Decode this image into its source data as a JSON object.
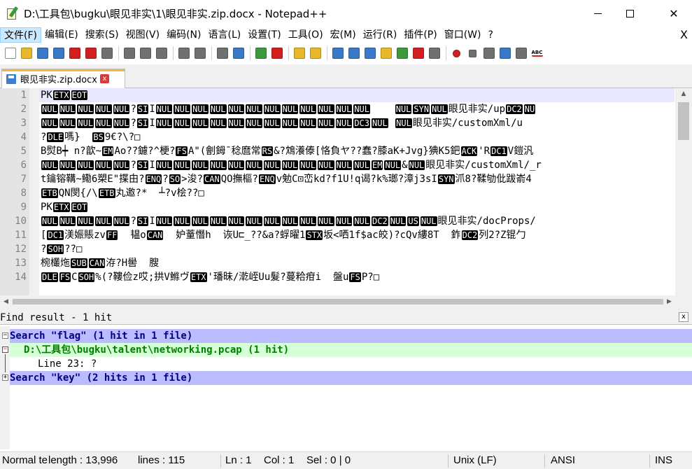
{
  "window": {
    "title": "D:\\工具包\\bugku\\眼见非实\\1\\眼见非实.zip.docx - Notepad++",
    "minimize_glyph": "",
    "maximize_glyph": "",
    "close_glyph": "✕"
  },
  "menu": {
    "items": [
      "文件(F)",
      "编辑(E)",
      "搜索(S)",
      "视图(V)",
      "编码(N)",
      "语言(L)",
      "设置(T)",
      "工具(O)",
      "宏(M)",
      "运行(R)",
      "插件(P)",
      "窗口(W)",
      "?"
    ],
    "close_x": "X"
  },
  "toolbar": {
    "icons": [
      "new-file-icon",
      "open-file-icon",
      "save-icon",
      "save-all-icon",
      "close-icon",
      "close-all-icon",
      "print-icon",
      "cut-icon",
      "copy-icon",
      "paste-icon",
      "undo-icon",
      "redo-icon",
      "find-icon",
      "replace-icon",
      "zoom-in-icon",
      "zoom-out-icon",
      "sync-v-icon",
      "sync-h-icon",
      "word-wrap-icon",
      "show-all-chars-icon",
      "indent-guide-icon",
      "doc-map-icon",
      "function-list-icon",
      "folder-workspace-icon",
      "monitor-icon",
      "record-macro-icon",
      "stop-macro-icon",
      "play-macro-icon",
      "run-macro-multiple-icon",
      "save-macro-icon",
      "spell-check-icon"
    ],
    "colors": {
      "blue": "#3a78c8",
      "green": "#3c9a3c",
      "red": "#d22020",
      "gray": "#707070",
      "yellow": "#e8b82a"
    }
  },
  "tab": {
    "label": "眼见非实.zip.docx",
    "close": "x"
  },
  "editor": {
    "line_numbers": [
      "1",
      "2",
      "3",
      "4",
      "5",
      "6",
      "7",
      "8",
      "9",
      "10",
      "11",
      "12",
      "13",
      "14"
    ],
    "lines": [
      [
        {
          "t": "PK"
        },
        {
          "k": "ETX"
        },
        {
          "k": "EOT"
        }
      ],
      [
        {
          "k": "NUL"
        },
        {
          "k": "NUL"
        },
        {
          "k": "NUL"
        },
        {
          "k": "NUL"
        },
        {
          "k": "NUL"
        },
        {
          "t": "?"
        },
        {
          "k": "SI"
        },
        {
          "t": "I"
        },
        {
          "k": "NUL"
        },
        {
          "k": "NUL"
        },
        {
          "k": "NUL"
        },
        {
          "k": "NUL"
        },
        {
          "k": "NUL"
        },
        {
          "k": "NUL"
        },
        {
          "k": "NUL"
        },
        {
          "k": "NUL"
        },
        {
          "k": "NUL"
        },
        {
          "k": "NUL"
        },
        {
          "k": "NUL"
        },
        {
          "k": "NUL"
        },
        {
          "t": "    "
        },
        {
          "k": "NUL"
        },
        {
          "k": "SYN"
        },
        {
          "k": "NUL"
        },
        {
          "t": "眼见非实/up"
        },
        {
          "k": "DC2"
        },
        {
          "k": "NU"
        }
      ],
      [
        {
          "k": "NUL"
        },
        {
          "k": "NUL"
        },
        {
          "k": "NUL"
        },
        {
          "k": "NUL"
        },
        {
          "k": "NUL"
        },
        {
          "t": "?"
        },
        {
          "k": "SI"
        },
        {
          "t": "I"
        },
        {
          "k": "NUL"
        },
        {
          "k": "NUL"
        },
        {
          "k": "NUL"
        },
        {
          "k": "NUL"
        },
        {
          "k": "NUL"
        },
        {
          "k": "NUL"
        },
        {
          "k": "NUL"
        },
        {
          "k": "NUL"
        },
        {
          "k": "NUL"
        },
        {
          "k": "NUL"
        },
        {
          "k": "NUL"
        },
        {
          "k": "DC3"
        },
        {
          "k": "NUL"
        },
        {
          "t": " "
        },
        {
          "k": "NUL"
        },
        {
          "t": "眼见非实/customXml/u"
        }
      ],
      [
        {
          "t": "?"
        },
        {
          "k": "DLE"
        },
        {
          "t": "嗎}  "
        },
        {
          "k": "BS"
        },
        {
          "t": "9€?\\?□"
        }
      ],
      [
        {
          "t": "B熨B┿ n?歆~"
        },
        {
          "k": "EM"
        },
        {
          "t": "Ao??鑢?^梗?"
        },
        {
          "k": "FS"
        },
        {
          "t": "A\"(劊鉧¯稔麿常"
        },
        {
          "k": "RS"
        },
        {
          "t": "&?鴆瀁傣[恪負ヤ??蠢?膝aK+Jvg}猠K5鈀"
        },
        {
          "k": "ACK"
        },
        {
          "t": "'R"
        },
        {
          "k": "DC1"
        },
        {
          "t": "V鎧汎"
        }
      ],
      [
        {
          "k": "NUL"
        },
        {
          "k": "NUL"
        },
        {
          "k": "NUL"
        },
        {
          "k": "NUL"
        },
        {
          "k": "NUL"
        },
        {
          "t": "?"
        },
        {
          "k": "SI"
        },
        {
          "t": "I"
        },
        {
          "k": "NUL"
        },
        {
          "k": "NUL"
        },
        {
          "k": "NUL"
        },
        {
          "k": "NUL"
        },
        {
          "k": "NUL"
        },
        {
          "k": "NUL"
        },
        {
          "k": "NUL"
        },
        {
          "k": "NUL"
        },
        {
          "k": "NUL"
        },
        {
          "k": "NUL"
        },
        {
          "k": "NUL"
        },
        {
          "k": "NUL"
        },
        {
          "k": "EM"
        },
        {
          "k": "NUL"
        },
        {
          "t": "&"
        },
        {
          "k": "NUL"
        },
        {
          "t": "眼见非实/customXml/_r"
        }
      ],
      [
        {
          "t": "t鑰镕鞲~鰳6槊E\"揲甶?"
        },
        {
          "k": "ENQ"
        },
        {
          "t": "?"
        },
        {
          "k": "SO"
        },
        {
          "t": ">浚?"
        },
        {
          "k": "CAN"
        },
        {
          "t": "QO撫樞?"
        },
        {
          "k": "ENQ"
        },
        {
          "t": "v勉C⊡峦kd?f1U!q谒?k%瑯?漳j3sI"
        },
        {
          "k": "SYN"
        },
        {
          "t": "沠8?鞣劬仳跋嵛4"
        }
      ],
      [
        {
          "k": "ETB"
        },
        {
          "t": "QN閔{/\\"
        },
        {
          "k": "ETB"
        },
        {
          "t": "丸邀?*  ┴?v桧??□"
        }
      ],
      [
        {
          "t": "PK"
        },
        {
          "k": "ETX"
        },
        {
          "k": "EOT"
        }
      ],
      [
        {
          "k": "NUL"
        },
        {
          "k": "NUL"
        },
        {
          "k": "NUL"
        },
        {
          "k": "NUL"
        },
        {
          "k": "NUL"
        },
        {
          "t": "?"
        },
        {
          "k": "SI"
        },
        {
          "t": "I"
        },
        {
          "k": "NUL"
        },
        {
          "k": "NUL"
        },
        {
          "k": "NUL"
        },
        {
          "k": "NUL"
        },
        {
          "k": "NUL"
        },
        {
          "k": "NUL"
        },
        {
          "k": "NUL"
        },
        {
          "k": "NUL"
        },
        {
          "k": "NUL"
        },
        {
          "k": "NUL"
        },
        {
          "k": "NUL"
        },
        {
          "k": "NUL"
        },
        {
          "k": "DC2"
        },
        {
          "k": "NUL"
        },
        {
          "k": "US"
        },
        {
          "k": "NUL"
        },
        {
          "t": "眼见非实/docProps/"
        }
      ],
      [
        {
          "t": "["
        },
        {
          "k": "DC1"
        },
        {
          "t": "渼娠賬zv"
        },
        {
          "k": "FF"
        },
        {
          "t": "  韫o"
        },
        {
          "k": "CAN"
        },
        {
          "t": "  妒蕫憯h  诙U⊏_??&a?蜉曜1"
        },
        {
          "k": "STX"
        },
        {
          "t": "坂<哂1f$ac皎)?cQv縷8T  鈼"
        },
        {
          "k": "DC2"
        },
        {
          "t": "列2?Z锟勹"
        }
      ],
      [
        {
          "t": "?"
        },
        {
          "k": "SOH"
        },
        {
          "t": "??□"
        }
      ],
      [
        {
          "t": "椀欉炧"
        },
        {
          "k": "SUB"
        },
        {
          "k": "CAN"
        },
        {
          "t": "洊?H嚳  膄"
        }
      ],
      [
        {
          "k": "DLE"
        },
        {
          "k": "FS"
        },
        {
          "t": "C"
        },
        {
          "k": "SOH"
        },
        {
          "t": "%(?鞻俭z哎;拱V鰷ヴ"
        },
        {
          "k": "ETX"
        },
        {
          "t": "'璠昧/漧峌Uu髮?蔓粭疳i  盤u"
        },
        {
          "k": "FS"
        },
        {
          "t": "P?□"
        }
      ]
    ]
  },
  "find_results": {
    "title": "Find result - 1 hit",
    "close": "x",
    "rows": [
      {
        "kind": "search",
        "text": "Search \"flag\" (1 hit in 1 file)",
        "fold": "⊟"
      },
      {
        "kind": "file",
        "text": "D:\\工具包\\bugku\\talent\\networking.pcap (1 hit)",
        "fold": "⊟"
      },
      {
        "kind": "hit",
        "text": "Line 23: ?",
        "fold": ""
      },
      {
        "kind": "search",
        "text": "Search \"key\" (2 hits in 1 file)",
        "fold": "⊞"
      }
    ]
  },
  "statusbar": {
    "type": "Normal te",
    "length": "length : 13,996",
    "lines": "lines : 115",
    "ln": "Ln : 1",
    "col": "Col : 1",
    "sel": "Sel : 0 | 0",
    "eol": "Unix (LF)",
    "encoding": "ANSI",
    "mode": "INS"
  }
}
